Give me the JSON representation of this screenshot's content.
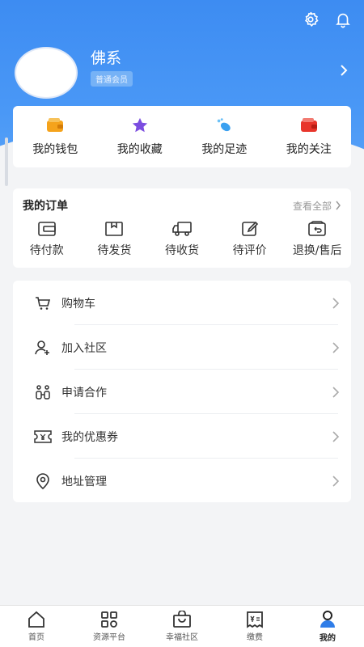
{
  "profile": {
    "username": "佛系",
    "member_badge": "普通会员"
  },
  "quick_links": [
    {
      "label": "我的钱包",
      "icon": "wallet-icon",
      "color": "#f5a31b"
    },
    {
      "label": "我的收藏",
      "icon": "star-icon",
      "color": "#7b4de0"
    },
    {
      "label": "我的足迹",
      "icon": "footprint-icon",
      "color": "#3aa0f0"
    },
    {
      "label": "我的关注",
      "icon": "follow-wallet-icon",
      "color": "#e8352b"
    }
  ],
  "orders": {
    "title": "我的订单",
    "view_all": "查看全部",
    "items": [
      {
        "label": "待付款",
        "icon": "wallet-outline-icon"
      },
      {
        "label": "待发货",
        "icon": "box-icon"
      },
      {
        "label": "待收货",
        "icon": "truck-icon"
      },
      {
        "label": "待评价",
        "icon": "edit-icon"
      },
      {
        "label": "退换/售后",
        "icon": "return-icon"
      }
    ]
  },
  "menu": [
    {
      "label": "购物车",
      "icon": "cart-icon"
    },
    {
      "label": "加入社区",
      "icon": "add-user-icon"
    },
    {
      "label": "申请合作",
      "icon": "cooperation-icon"
    },
    {
      "label": "我的优惠券",
      "icon": "coupon-icon"
    },
    {
      "label": "地址管理",
      "icon": "location-icon"
    }
  ],
  "tabs": [
    {
      "label": "首页",
      "icon": "home-icon"
    },
    {
      "label": "资源平台",
      "icon": "grid-icon"
    },
    {
      "label": "幸福社区",
      "icon": "bag-icon"
    },
    {
      "label": "缴费",
      "icon": "bill-icon"
    },
    {
      "label": "我的",
      "icon": "user-icon",
      "active": true
    }
  ],
  "colors": {
    "header_blue": "#3d8cf2",
    "accent_blue": "#2f7de8"
  }
}
